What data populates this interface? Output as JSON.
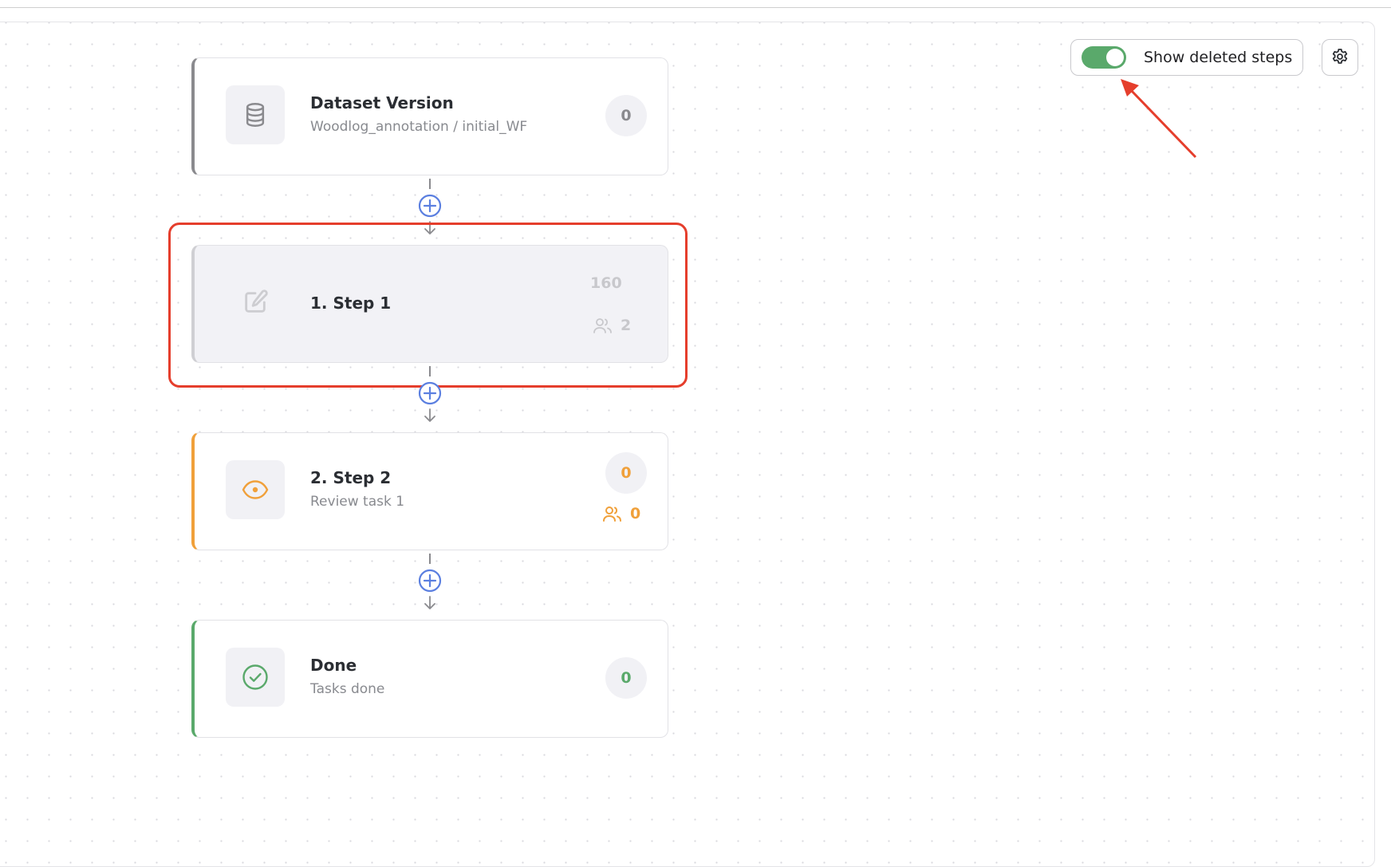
{
  "toolbar": {
    "show_deleted_label": "Show deleted steps",
    "show_deleted_on": true,
    "settings_icon": "gear-icon"
  },
  "colors": {
    "neutral": "#8a8a8e",
    "deleted": "#cfcfd3",
    "review": "#f0a03a",
    "done": "#5aa96b",
    "add": "#5b7fe0",
    "annotation": "#e53e2c"
  },
  "workflow": {
    "dataset": {
      "title": "Dataset Version",
      "subtitle": "Woodlog_annotation / initial_WF",
      "count": "0",
      "icon": "database-icon"
    },
    "steps": [
      {
        "title": "1. Step 1",
        "subtitle": "",
        "count": "160",
        "assignees": "2",
        "icon": "edit-icon",
        "deleted": true
      },
      {
        "title": "2. Step 2",
        "subtitle": "Review task 1",
        "count": "0",
        "assignees": "0",
        "icon": "eye-icon",
        "deleted": false
      }
    ],
    "done": {
      "title": "Done",
      "subtitle": "Tasks done",
      "count": "0",
      "icon": "check-circle-icon"
    }
  }
}
